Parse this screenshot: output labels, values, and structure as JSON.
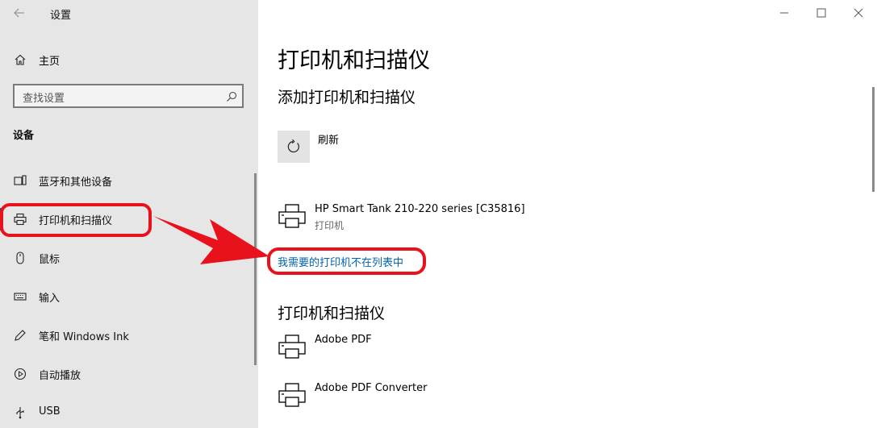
{
  "window": {
    "app_title": "设置"
  },
  "sidebar": {
    "home_label": "主页",
    "search_placeholder": "查找设置",
    "section": "设备",
    "items": [
      {
        "label": "蓝牙和其他设备"
      },
      {
        "label": "打印机和扫描仪"
      },
      {
        "label": "鼠标"
      },
      {
        "label": "输入"
      },
      {
        "label": "笔和 Windows Ink"
      },
      {
        "label": "自动播放"
      },
      {
        "label": "USB"
      }
    ]
  },
  "main": {
    "page_title": "打印机和扫描仪",
    "add_section_title": "添加打印机和扫描仪",
    "refresh_label": "刷新",
    "discovered_device": {
      "name": "HP Smart Tank 210-220 series [C35816]",
      "type": "打印机"
    },
    "missing_link": "我需要的打印机不在列表中",
    "printers_section_title": "打印机和扫描仪",
    "printers": [
      {
        "name": "Adobe PDF"
      },
      {
        "name": "Adobe PDF Converter"
      }
    ]
  },
  "colors": {
    "accent": "#0063b1",
    "annotation": "#e8121c",
    "sidebar_bg": "#e6e6e6"
  },
  "icons": [
    "back-arrow-icon",
    "home-icon",
    "search-icon",
    "bluetooth-devices-icon",
    "printer-icon",
    "mouse-icon",
    "keyboard-icon",
    "pen-icon",
    "autoplay-icon",
    "usb-icon",
    "refresh-icon",
    "minimize-icon",
    "maximize-icon",
    "close-icon"
  ]
}
